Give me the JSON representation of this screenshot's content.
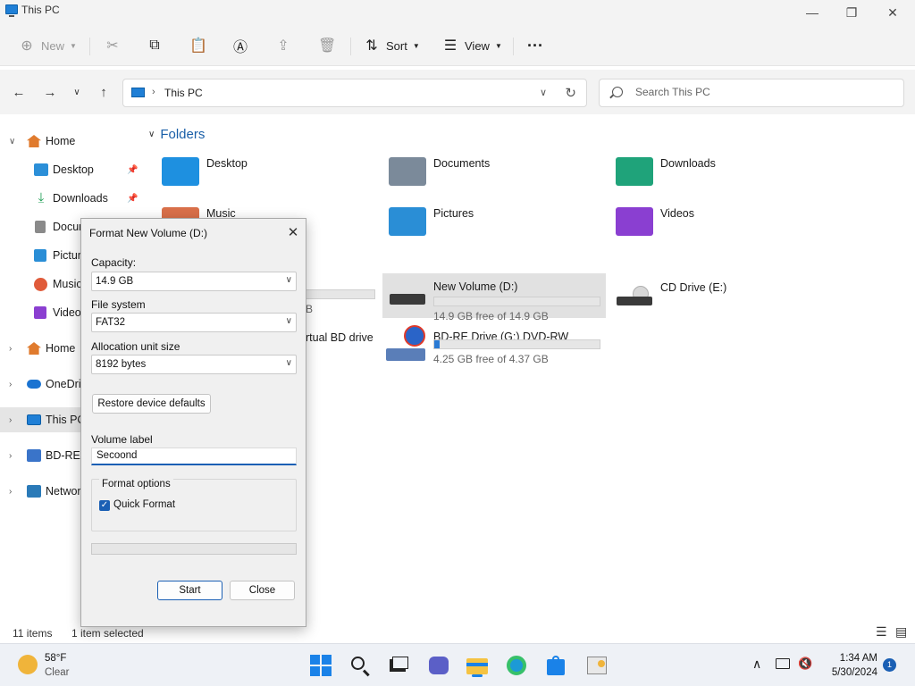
{
  "window": {
    "title": "This PC",
    "app_icon": "computer-icon",
    "minimize_glyph": "—",
    "maximize_glyph": "❐",
    "close_glyph": "✕"
  },
  "commandbar": {
    "new_label": "New",
    "sort_label": "Sort",
    "view_label": "View",
    "more_glyph": "···"
  },
  "address": {
    "separator": "›",
    "path": "This PC",
    "refresh_glyph": "↻"
  },
  "search": {
    "placeholder": "Search This PC"
  },
  "sidebar": {
    "items": [
      {
        "label": "Home",
        "icon": "home-icon",
        "color": "#e07b2e"
      },
      {
        "label": "Desktop",
        "icon": "desktop-icon",
        "color": "#2b8fd8"
      },
      {
        "label": "Downloads",
        "icon": "download-icon",
        "color": "#1f9e55"
      },
      {
        "label": "Docur",
        "icon": "documents-icon",
        "color": "#8a8a8a"
      },
      {
        "label": "Pictur",
        "icon": "pictures-icon",
        "color": "#2a8ed6"
      },
      {
        "label": "Music",
        "icon": "music-icon",
        "color": "#e05b3a"
      },
      {
        "label": "Video",
        "icon": "videos-icon",
        "color": "#8b3fd1"
      },
      {
        "label": "Home",
        "icon": "home-icon",
        "color": "#e07b2e"
      },
      {
        "label": "OneDriv",
        "icon": "cloud-icon",
        "color": "#1a73d1"
      },
      {
        "label": "This PC",
        "icon": "computer-icon",
        "color": "#1f7fd6"
      },
      {
        "label": "BD-RE D",
        "icon": "disc-drive-icon",
        "color": "#3a74c9"
      },
      {
        "label": "Networ",
        "icon": "network-icon",
        "color": "#2a7ab8"
      }
    ]
  },
  "main": {
    "group_title": "Folders",
    "folders": [
      {
        "label": "Desktop",
        "icon": "desktop-folder-icon",
        "color": "#1e90e0"
      },
      {
        "label": "Documents",
        "icon": "documents-folder-icon",
        "color": "#7b8a9a"
      },
      {
        "label": "Downloads",
        "icon": "downloads-folder-icon",
        "color": "#1fa37a"
      },
      {
        "label": "Music",
        "icon": "music-folder-icon",
        "color": "#d9704a"
      },
      {
        "label": "Pictures",
        "icon": "pictures-folder-icon",
        "color": "#2a8ed6"
      },
      {
        "label": "Videos",
        "icon": "videos-folder-icon",
        "color": "#8a3fd1"
      }
    ],
    "hidden_drive_fragment_free": "B",
    "hidden_drive_fragment_label": "rtual BD drive",
    "drives": [
      {
        "label": "New Volume (D:)",
        "free": "14.9 GB free of 14.9 GB",
        "used_fraction": 0.0
      },
      {
        "label": "CD Drive (E:)"
      },
      {
        "label": "BD-RE Drive (G:) DVD-RW",
        "free": "4.25 GB free of 4.37 GB",
        "used_fraction": 0.03
      }
    ]
  },
  "status": {
    "items_count": "11 items",
    "selected": "1 item selected"
  },
  "dialog": {
    "title": "Format New Volume (D:)",
    "capacity_label": "Capacity:",
    "capacity_value": "14.9 GB",
    "filesystem_label": "File system",
    "filesystem_value": "FAT32",
    "allocation_label": "Allocation unit size",
    "allocation_value": "8192 bytes",
    "restore_label": "Restore device defaults",
    "volume_label_label": "Volume label",
    "volume_label_value": "Secoond",
    "format_options_label": "Format options",
    "quick_format_label": "Quick Format",
    "quick_format_checked": true,
    "start_label": "Start",
    "close_label": "Close",
    "progress_fraction": 0.0
  },
  "taskbar": {
    "weather_temp": "58°F",
    "weather_cond": "Clear",
    "time": "1:34 AM",
    "date": "5/30/2024",
    "notification_count": "1"
  }
}
